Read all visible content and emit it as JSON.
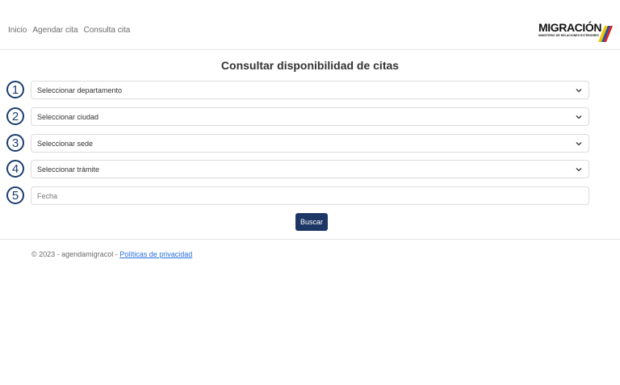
{
  "nav": {
    "links": [
      "Inicio",
      "Agendar cita",
      "Consulta cita"
    ]
  },
  "logo": {
    "word": "MIGRACIÓN",
    "subtitle": "MINISTERIO DE RELACIONES EXTERIORES"
  },
  "page": {
    "title": "Consultar disponibilidad de citas"
  },
  "form": {
    "fields": [
      {
        "step": "1",
        "label": "Seleccionar departamento",
        "kind": "select"
      },
      {
        "step": "2",
        "label": "Seleccionar ciudad",
        "kind": "select"
      },
      {
        "step": "3",
        "label": "Seleccionar sede",
        "kind": "select"
      },
      {
        "step": "4",
        "label": "Seleccionar trámite",
        "kind": "select"
      },
      {
        "step": "5",
        "label": "Fecha",
        "kind": "input"
      }
    ],
    "submit_label": "Buscar"
  },
  "footer": {
    "copyright": "© 2023 - agendamigracol - ",
    "privacy_link": "Políticas de privacidad"
  },
  "colors": {
    "primary": "#1c3766",
    "badge": "#1b3d6e",
    "link": "#2a6fdb"
  }
}
